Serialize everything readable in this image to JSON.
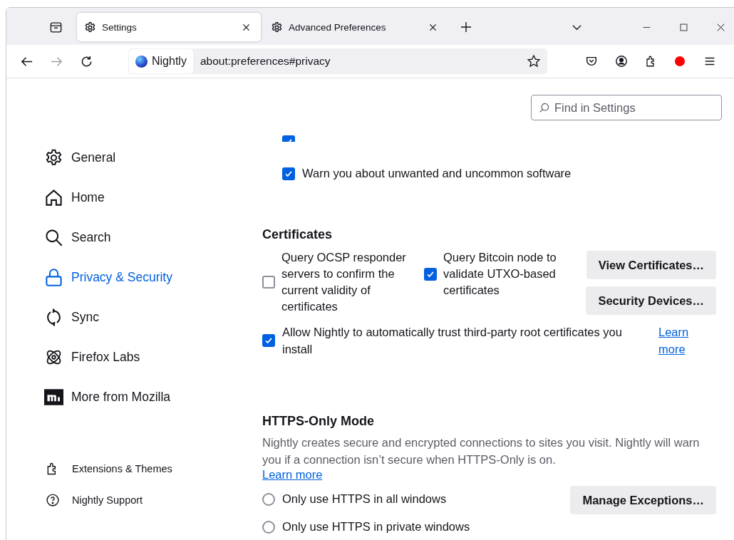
{
  "tabs": [
    {
      "label": "Settings",
      "selected": true
    },
    {
      "label": "Advanced Preferences",
      "selected": false
    }
  ],
  "toolbar": {
    "identity": "Nightly",
    "url": "about:preferences#privacy"
  },
  "search": {
    "placeholder": "Find in Settings"
  },
  "sidebar": {
    "categories": [
      {
        "label": "General",
        "kind": "gear",
        "selected": false
      },
      {
        "label": "Home",
        "kind": "home",
        "selected": false
      },
      {
        "label": "Search",
        "kind": "search",
        "selected": false
      },
      {
        "label": "Privacy & Security",
        "kind": "lock",
        "selected": true
      },
      {
        "label": "Sync",
        "kind": "sync",
        "selected": false
      },
      {
        "label": "Firefox Labs",
        "kind": "atom",
        "selected": false
      },
      {
        "label": "More from Mozilla",
        "kind": "mozilla",
        "selected": false
      }
    ],
    "footer": [
      {
        "label": "Extensions & Themes",
        "kind": "puzzle"
      },
      {
        "label": "Nightly Support",
        "kind": "help"
      }
    ]
  },
  "security": {
    "partial_checkbox": {
      "checked": true
    },
    "warn_checkbox": {
      "label": "Warn you about unwanted and uncommon software",
      "checked": true
    }
  },
  "certificates": {
    "heading": "Certificates",
    "options": [
      {
        "label": "Query OCSP responder servers to confirm the current validity of certificates",
        "checked": false
      },
      {
        "label": "Query Bitcoin node to validate UTXO-based certificates",
        "checked": true
      }
    ],
    "buttons": [
      "View Certificates…",
      "Security Devices…"
    ],
    "trust": {
      "label": "Allow Nightly to automatically trust third-party root certificates you install",
      "checked": true,
      "link": "Learn more"
    }
  },
  "https_only": {
    "heading": "HTTPS-Only Mode",
    "description": "Nightly creates secure and encrypted connections to sites you visit. Nightly will warn you if a connection isn’t secure when HTTPS-Only is on.",
    "link": "Learn more",
    "options": [
      {
        "label": "Only use HTTPS in all windows",
        "selected": false
      },
      {
        "label": "Only use HTTPS in private windows",
        "selected": false
      }
    ],
    "button": "Manage Exceptions…"
  }
}
